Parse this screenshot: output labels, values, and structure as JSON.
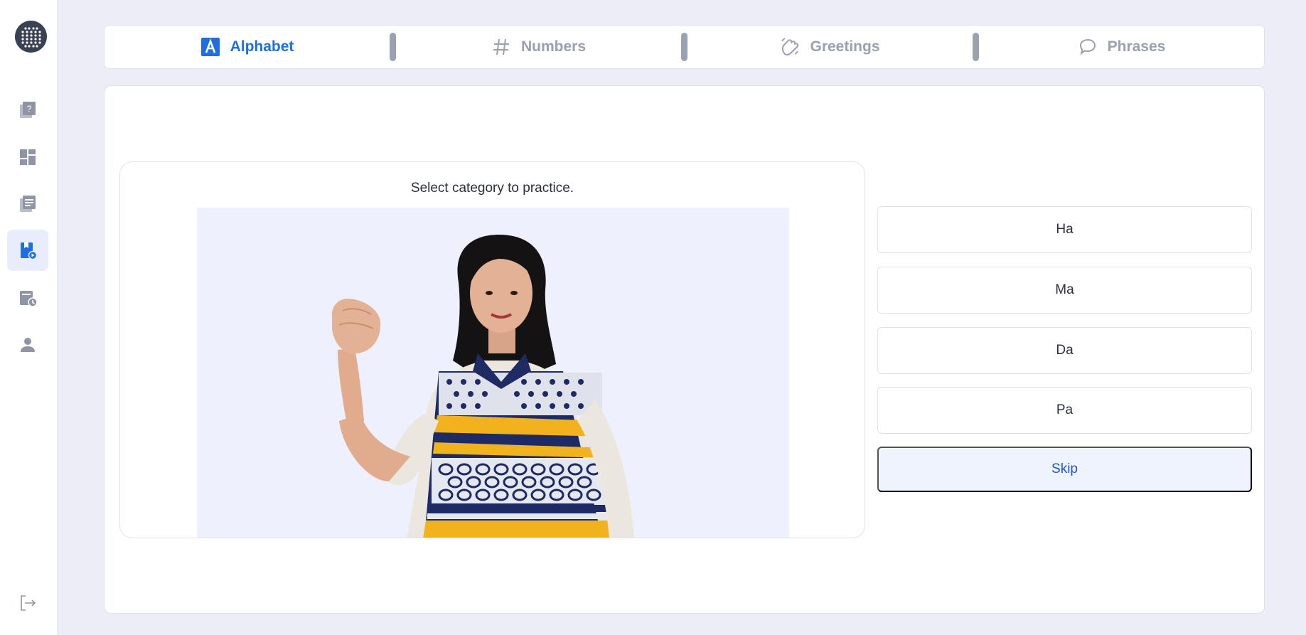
{
  "sidebar": {
    "items": [
      {
        "icon": "quiz-icon",
        "active": false
      },
      {
        "icon": "dashboard-icon",
        "active": false
      },
      {
        "icon": "lessons-icon",
        "active": false
      },
      {
        "icon": "practice-icon",
        "active": true
      },
      {
        "icon": "history-icon",
        "active": false
      },
      {
        "icon": "profile-icon",
        "active": false
      }
    ],
    "logout_icon": "logout-icon"
  },
  "tabs": [
    {
      "label": "Alphabet",
      "icon": "alphabet-icon",
      "active": true
    },
    {
      "label": "Numbers",
      "icon": "hash-icon",
      "active": false
    },
    {
      "label": "Greetings",
      "icon": "wave-hand-icon",
      "active": false
    },
    {
      "label": "Phrases",
      "icon": "speech-bubble-icon",
      "active": false
    }
  ],
  "practice": {
    "prompt": "Select category to practice.",
    "answers": [
      "Ha",
      "Ma",
      "Da",
      "Pa"
    ],
    "skip_label": "Skip"
  },
  "colors": {
    "accent": "#1f6fe0",
    "background": "#ecedf6",
    "inactive": "#9aa0ae"
  }
}
